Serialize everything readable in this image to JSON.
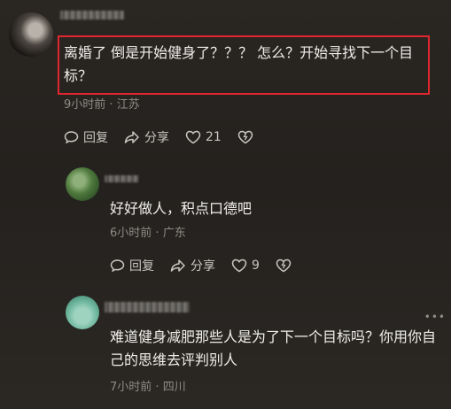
{
  "comments": [
    {
      "text": "离婚了 倒是开始健身了？？？ 怎么？开始寻找下一个目标？",
      "time": "9小时前",
      "location": "江苏",
      "reply_label": "回复",
      "share_label": "分享",
      "likes": "21"
    },
    {
      "text": "好好做人，积点口德吧",
      "time": "6小时前",
      "location": "广东",
      "reply_label": "回复",
      "share_label": "分享",
      "likes": "9"
    },
    {
      "text": "难道健身减肥那些人是为了下一个目标吗？你用你自己的思维去评判别人",
      "time": "7小时前",
      "location": "四川"
    }
  ],
  "meta_separator": "·",
  "more_label": "•••",
  "colors": {
    "highlight_box": "#e0262f",
    "background": "#26231f"
  },
  "icons": [
    "reply-icon",
    "share-icon",
    "like-icon",
    "dislike-icon",
    "more-icon"
  ]
}
